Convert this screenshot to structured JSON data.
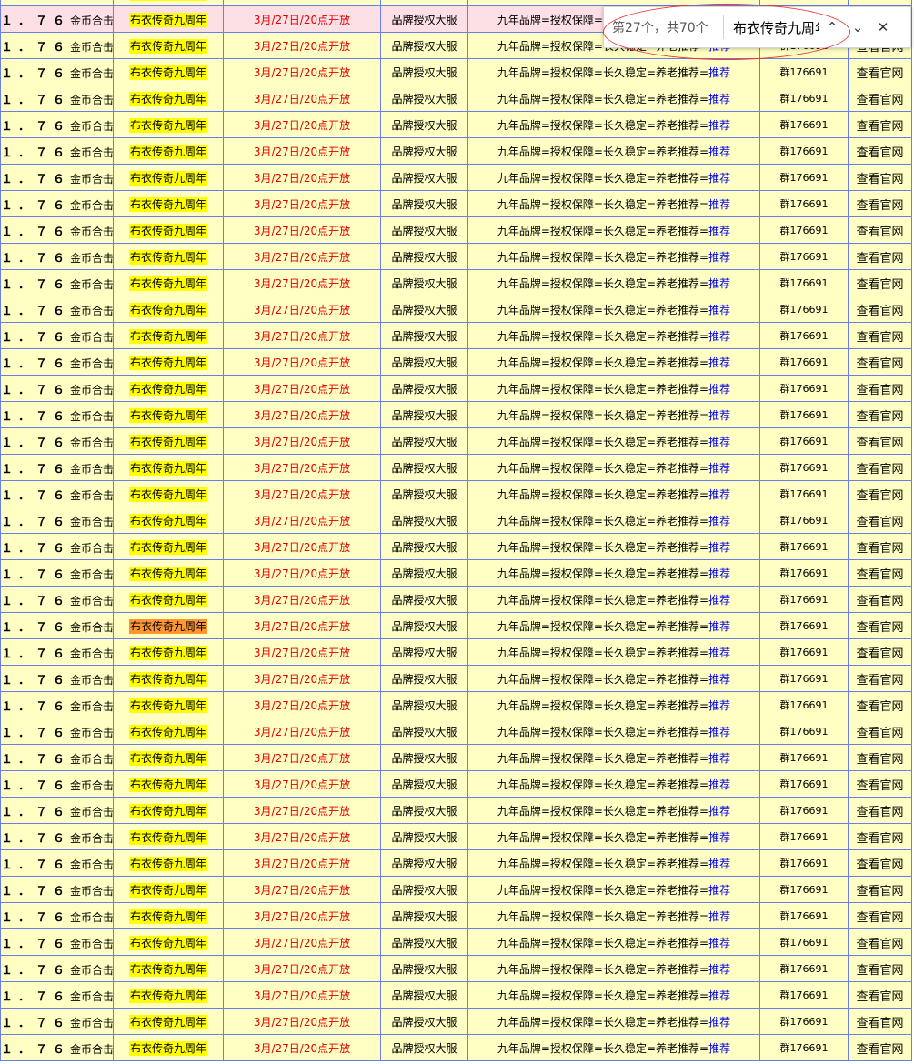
{
  "row": {
    "coin": "１．７６",
    "coin_suffix": "金币合击",
    "name": "布衣传奇九周年",
    "open": "3月/27日/20点开放",
    "brand": "品牌授权大服",
    "slogan": "九年品牌=授权保障=长久稳定=养老推荐=",
    "slogan_link": "推荐",
    "group": "群176691",
    "site": "查看官网"
  },
  "row_count": 41,
  "current_row_index": 1,
  "active_match_row_index": 24,
  "find": {
    "count": "第27个，共70个",
    "query": "布衣传奇九周年"
  },
  "colors": {
    "table_bg": "#ffffc3",
    "border": "#6b7ee6",
    "highlight": "#ffff00",
    "active_highlight": "#ff9632",
    "open_text": "#e00000",
    "link": "#0000ee"
  }
}
